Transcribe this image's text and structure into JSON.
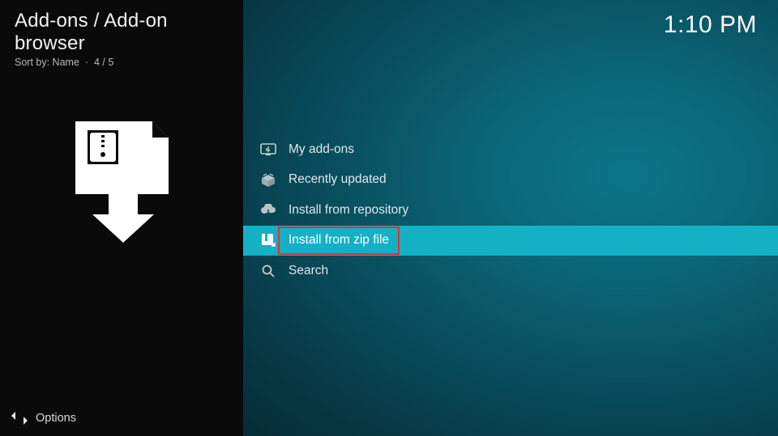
{
  "header": {
    "breadcrumb": "Add-ons / Add-on browser",
    "sort_prefix": "Sort by: ",
    "sort_field": "Name",
    "position": "4 / 5"
  },
  "clock": "1:10 PM",
  "menu": {
    "items": [
      {
        "label": "My add-ons",
        "icon": "my-addons-icon",
        "selected": false
      },
      {
        "label": "Recently updated",
        "icon": "box-open-icon",
        "selected": false
      },
      {
        "label": "Install from repository",
        "icon": "cloud-down-icon",
        "selected": false
      },
      {
        "label": "Install from zip file",
        "icon": "zip-file-icon",
        "selected": true
      },
      {
        "label": "Search",
        "icon": "search-icon",
        "selected": false
      }
    ]
  },
  "footer": {
    "options_label": "Options"
  }
}
